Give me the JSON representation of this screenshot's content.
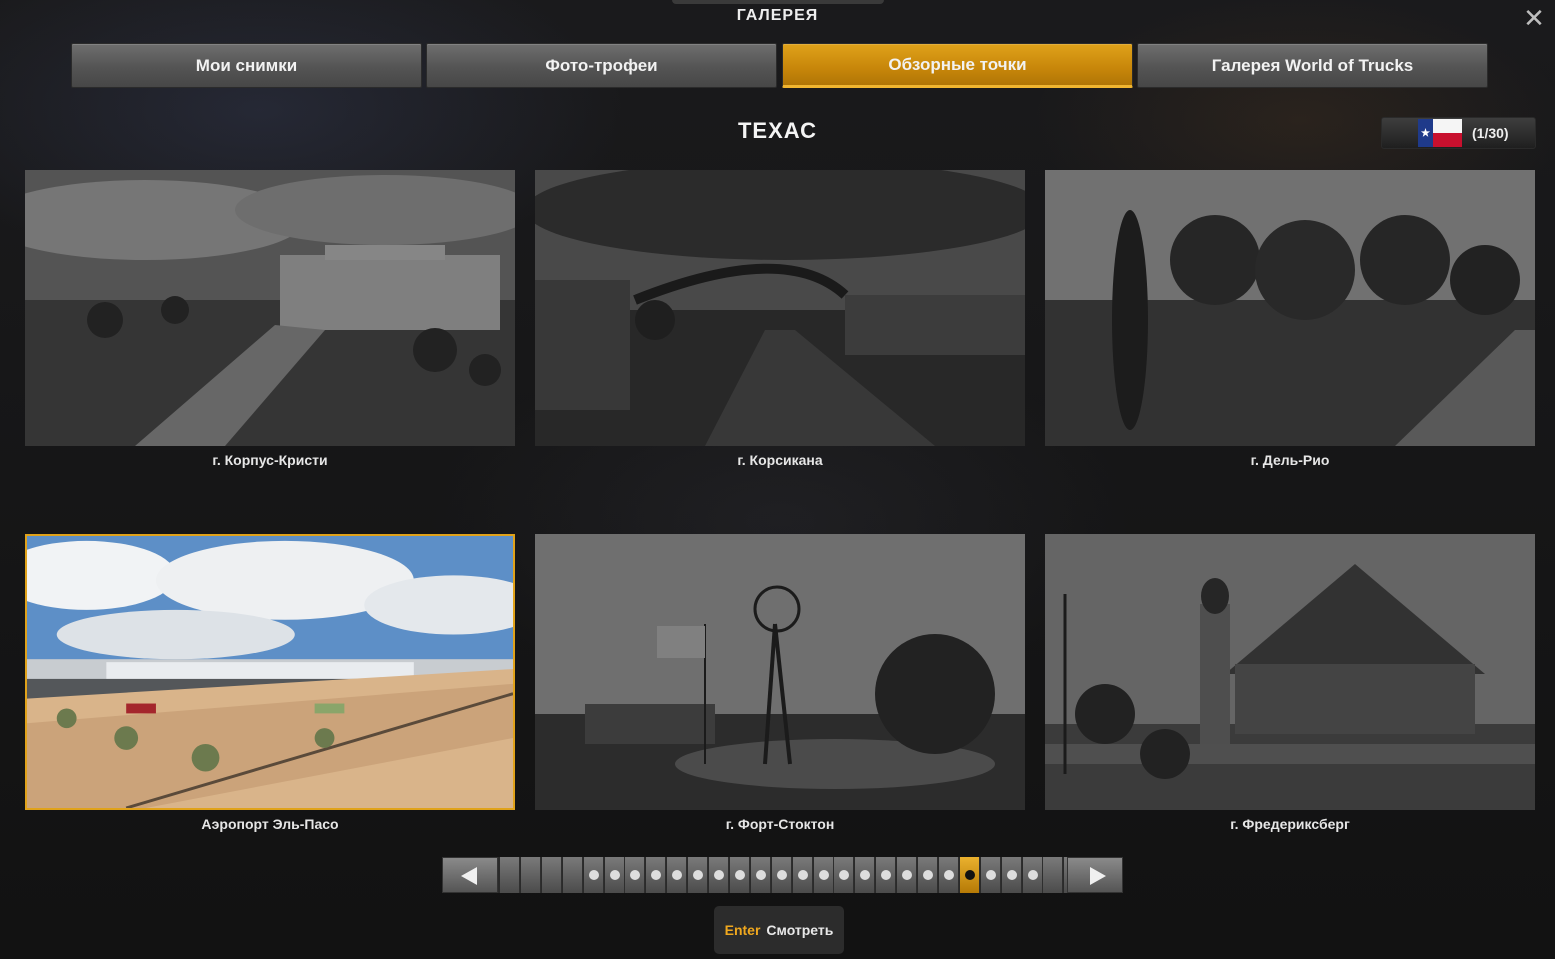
{
  "window": {
    "title": "ГАЛЕРЕЯ",
    "close_icon": "close-icon"
  },
  "tabs": [
    {
      "label": "Мои снимки",
      "active": false
    },
    {
      "label": "Фото-трофеи",
      "active": false
    },
    {
      "label": "Обзорные точки",
      "active": true
    },
    {
      "label": "Галерея World of Trucks",
      "active": false
    }
  ],
  "region": {
    "title": "ТЕХАС",
    "counter": "(1/30)",
    "flag_icon": "texas-flag-icon"
  },
  "cards": [
    {
      "caption": "г. Корпус-Кристи",
      "selected": false
    },
    {
      "caption": "г. Корсикана",
      "selected": false
    },
    {
      "caption": "г. Дель-Рио",
      "selected": false
    },
    {
      "caption": "Аэропорт Эль-Пасо",
      "selected": true
    },
    {
      "caption": "г. Форт-Стоктон",
      "selected": false
    },
    {
      "caption": "г. Фредериксберг",
      "selected": false
    }
  ],
  "pager": {
    "prev_icon": "arrow-left-icon",
    "next_icon": "arrow-right-icon",
    "cells": [
      "",
      "",
      "",
      "",
      "dot",
      "dot",
      "dot",
      "dot",
      "dot",
      "dot",
      "dot",
      "dot",
      "dot",
      "dot",
      "dot",
      "dot",
      "dot",
      "dot",
      "dot",
      "dot",
      "dot",
      "dot",
      "current",
      "dot",
      "dot",
      "dot",
      "",
      "",
      ""
    ]
  },
  "hint": {
    "key": "Enter",
    "action": "Смотреть"
  },
  "colors": {
    "accent": "#e0a21a",
    "tab": "#5a5a5a",
    "background": "#151515"
  }
}
